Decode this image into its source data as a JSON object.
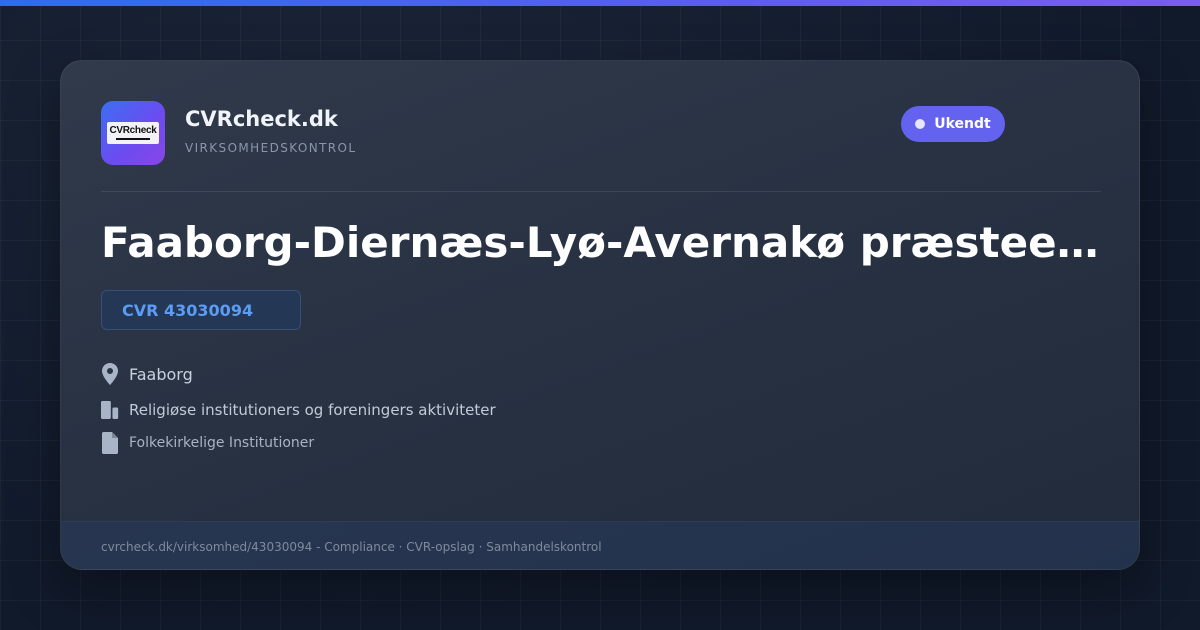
{
  "brand": {
    "name": "CVRcheck.dk",
    "tagline": "VIRKSOMHEDSKONTROL",
    "logo_text": "CVRcheck"
  },
  "status": {
    "label": "Ukendt",
    "color": "#6363f0"
  },
  "company": {
    "name": "Faaborg-Diernæs-Lyø-Avernakø præsteembede",
    "cvr_label": "CVR 43030094"
  },
  "details": {
    "location": "Faaborg",
    "industry": "Religiøse institutioners og foreningers aktiviteter",
    "legal_form": "Folkekirkelige Institutioner"
  },
  "icons": {
    "location": "map-pin-icon",
    "industry": "building-icon",
    "legal_form": "document-icon"
  },
  "footer": {
    "text": "cvrcheck.dk/virksomhed/43030094 - Compliance · CVR-opslag · Samhandelskontrol"
  },
  "colors": {
    "accent": "#5b9cf5",
    "top_bar_start": "#2f6bf0",
    "top_bar_end": "#7b5cf2",
    "background": "#111a2b"
  }
}
